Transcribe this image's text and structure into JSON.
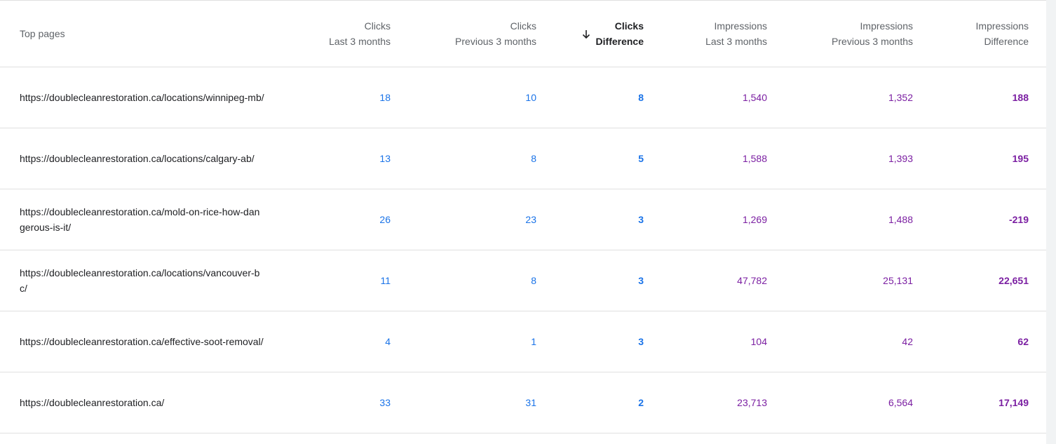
{
  "table": {
    "columns": {
      "page": "Top pages",
      "clicks_last": [
        "Clicks",
        "Last 3 months"
      ],
      "clicks_prev": [
        "Clicks",
        "Previous 3 months"
      ],
      "clicks_diff": [
        "Clicks",
        "Difference"
      ],
      "impr_last": [
        "Impressions",
        "Last 3 months"
      ],
      "impr_prev": [
        "Impressions",
        "Previous 3 months"
      ],
      "impr_diff": [
        "Impressions",
        "Difference"
      ]
    },
    "sort": {
      "column": "clicks_diff",
      "direction": "descending",
      "icon": "arrow-down-icon"
    },
    "rows": [
      {
        "url": "https://doublecleanrestoration.ca/locations/winnipeg-mb/",
        "clicks_last": "18",
        "clicks_prev": "10",
        "clicks_diff": "8",
        "impr_last": "1,540",
        "impr_prev": "1,352",
        "impr_diff": "188"
      },
      {
        "url": "https://doublecleanrestoration.ca/locations/calgary-ab/",
        "clicks_last": "13",
        "clicks_prev": "8",
        "clicks_diff": "5",
        "impr_last": "1,588",
        "impr_prev": "1,393",
        "impr_diff": "195"
      },
      {
        "url": "https://doublecleanrestoration.ca/mold-on-rice-how-dangerous-is-it/",
        "clicks_last": "26",
        "clicks_prev": "23",
        "clicks_diff": "3",
        "impr_last": "1,269",
        "impr_prev": "1,488",
        "impr_diff": "-219"
      },
      {
        "url": "https://doublecleanrestoration.ca/locations/vancouver-bc/",
        "clicks_last": "11",
        "clicks_prev": "8",
        "clicks_diff": "3",
        "impr_last": "47,782",
        "impr_prev": "25,131",
        "impr_diff": "22,651"
      },
      {
        "url": "https://doublecleanrestoration.ca/effective-soot-removal/",
        "clicks_last": "4",
        "clicks_prev": "1",
        "clicks_diff": "3",
        "impr_last": "104",
        "impr_prev": "42",
        "impr_diff": "62"
      },
      {
        "url": "https://doublecleanrestoration.ca/",
        "clicks_last": "33",
        "clicks_prev": "31",
        "clicks_diff": "2",
        "impr_last": "23,713",
        "impr_prev": "6,564",
        "impr_diff": "17,149"
      }
    ]
  },
  "colors": {
    "clicks": "#1a73e8",
    "impressions": "#7b1fa2",
    "text": "#202124",
    "muted": "#5f6368"
  }
}
